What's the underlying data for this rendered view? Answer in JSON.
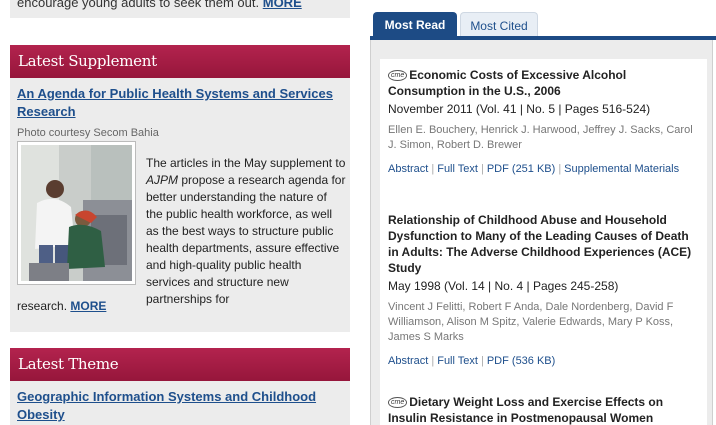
{
  "top": {
    "text": "encourage young adults to seek them out.",
    "more": "MORE"
  },
  "supplement": {
    "header": "Latest Supplement",
    "title": "An Agenda for Public Health Systems and Services Research",
    "photo_credit": "Photo courtesy Secom Bahia",
    "body_pre": "The articles in the May supplement to ",
    "journal": "AJPM",
    "body_post": " propose a research agenda for better understanding the nature of the public health workforce, as well as the best ways to structure public health departments, assure effective and high-quality public health services and structure new partnerships for",
    "tail": "research.",
    "more": "MORE"
  },
  "theme": {
    "header": "Latest Theme",
    "title": "Geographic Information Systems and Childhood Obesity"
  },
  "tabs": [
    {
      "label": "Most Read",
      "active": true
    },
    {
      "label": "Most Cited",
      "active": false
    }
  ],
  "articles": [
    {
      "cme": "cme",
      "title": "Economic Costs of Excessive Alcohol Consumption in the U.S., 2006",
      "meta": "November 2011 (Vol. 41 | No. 5 | Pages 516-524)",
      "authors": "Ellen E. Bouchery, Henrick J. Harwood, Jeffrey J. Sacks, Carol J. Simon, Robert D. Brewer",
      "links": [
        "Abstract",
        "Full Text",
        "PDF (251 KB)",
        "Supplemental Materials"
      ]
    },
    {
      "cme": "",
      "title": "Relationship of Childhood Abuse and Household Dysfunction to Many of the Leading Causes of Death in Adults: The Adverse Childhood Experiences (ACE) Study",
      "meta": "May 1998 (Vol. 14 | No. 4 | Pages 245-258)",
      "authors": "Vincent J Felitti, Robert F Anda, Dale Nordenberg, David F Williamson, Alison M Spitz, Valerie Edwards, Mary P Koss, James S Marks",
      "links": [
        "Abstract",
        "Full Text",
        "PDF (536 KB)"
      ]
    },
    {
      "cme": "cme",
      "title": "Dietary Weight Loss and Exercise Effects on Insulin Resistance in Postmenopausal Women",
      "meta": "",
      "authors": "",
      "links": []
    }
  ],
  "colors": {
    "header_red": "#a71d47",
    "link_blue": "#1e4f8c",
    "tab_blue": "#1d4b85",
    "panel_gray": "#ececec"
  }
}
